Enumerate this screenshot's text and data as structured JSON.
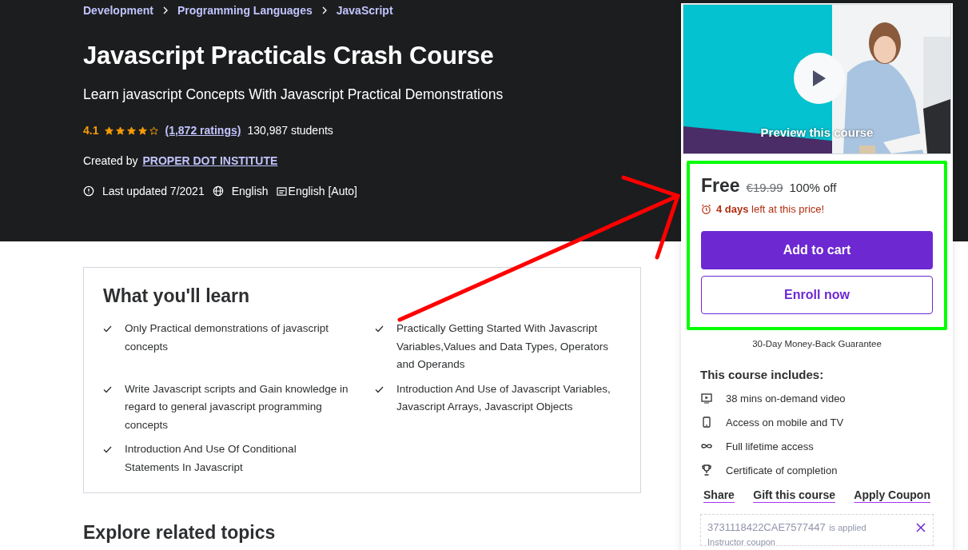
{
  "breadcrumbs": [
    "Development",
    "Programming Languages",
    "JavaScript"
  ],
  "title": "Javascript Practicals Crash Course",
  "subtitle": "Learn javascript Concepts With Javascript Practical Demonstrations",
  "rating": {
    "score": "4.1",
    "stars": 4,
    "ratings": "(1,872 ratings)",
    "students": "130,987 students"
  },
  "created_by": {
    "label": "Created by",
    "author": "PROPER DOT INSTITUTE"
  },
  "meta": [
    {
      "kind": "updated",
      "text": "Last updated 7/2021"
    },
    {
      "kind": "language",
      "text": "English"
    },
    {
      "kind": "captions",
      "text": "English [Auto]"
    }
  ],
  "learn": {
    "heading": "What you'll learn",
    "items": [
      "Only Practical demonstrations of javascript concepts",
      "Practically Getting Started With Javascript Variables,Values and Data Types, Operators and Operands",
      "Write Javascript scripts and Gain knowledge in regard to general javascript programming concepts",
      "Introduction And Use of Javascript Variables, Javascript Arrays, Javascript Objects",
      "Introduction And Use Of Conditional Statements In Javascript"
    ]
  },
  "explore_heading": "Explore related topics",
  "sidebar": {
    "preview": {
      "label": "Preview this course"
    },
    "price": "Free",
    "original_price": "€19.99",
    "discount": "100% off",
    "deadline": "**4 days** left at this price!",
    "buttons": [
      "Add to cart",
      "Enroll now"
    ],
    "guarantee": "30-Day Money-Back Guarantee",
    "includes_heading": "This course includes:",
    "includes": [
      {
        "kind": "video",
        "text": "38 mins on-demand video"
      },
      {
        "kind": "mobile",
        "text": "Access on mobile and TV"
      },
      {
        "kind": "lifetime",
        "text": "Full lifetime access"
      },
      {
        "kind": "certificate",
        "text": "Certificate of completion"
      }
    ],
    "links": [
      "Share",
      "Gift this course",
      "Apply Coupon"
    ],
    "coupon": {
      "code": "3731118422CAE7577447",
      "status": "is applied",
      "note": "Instructor coupon"
    }
  }
}
